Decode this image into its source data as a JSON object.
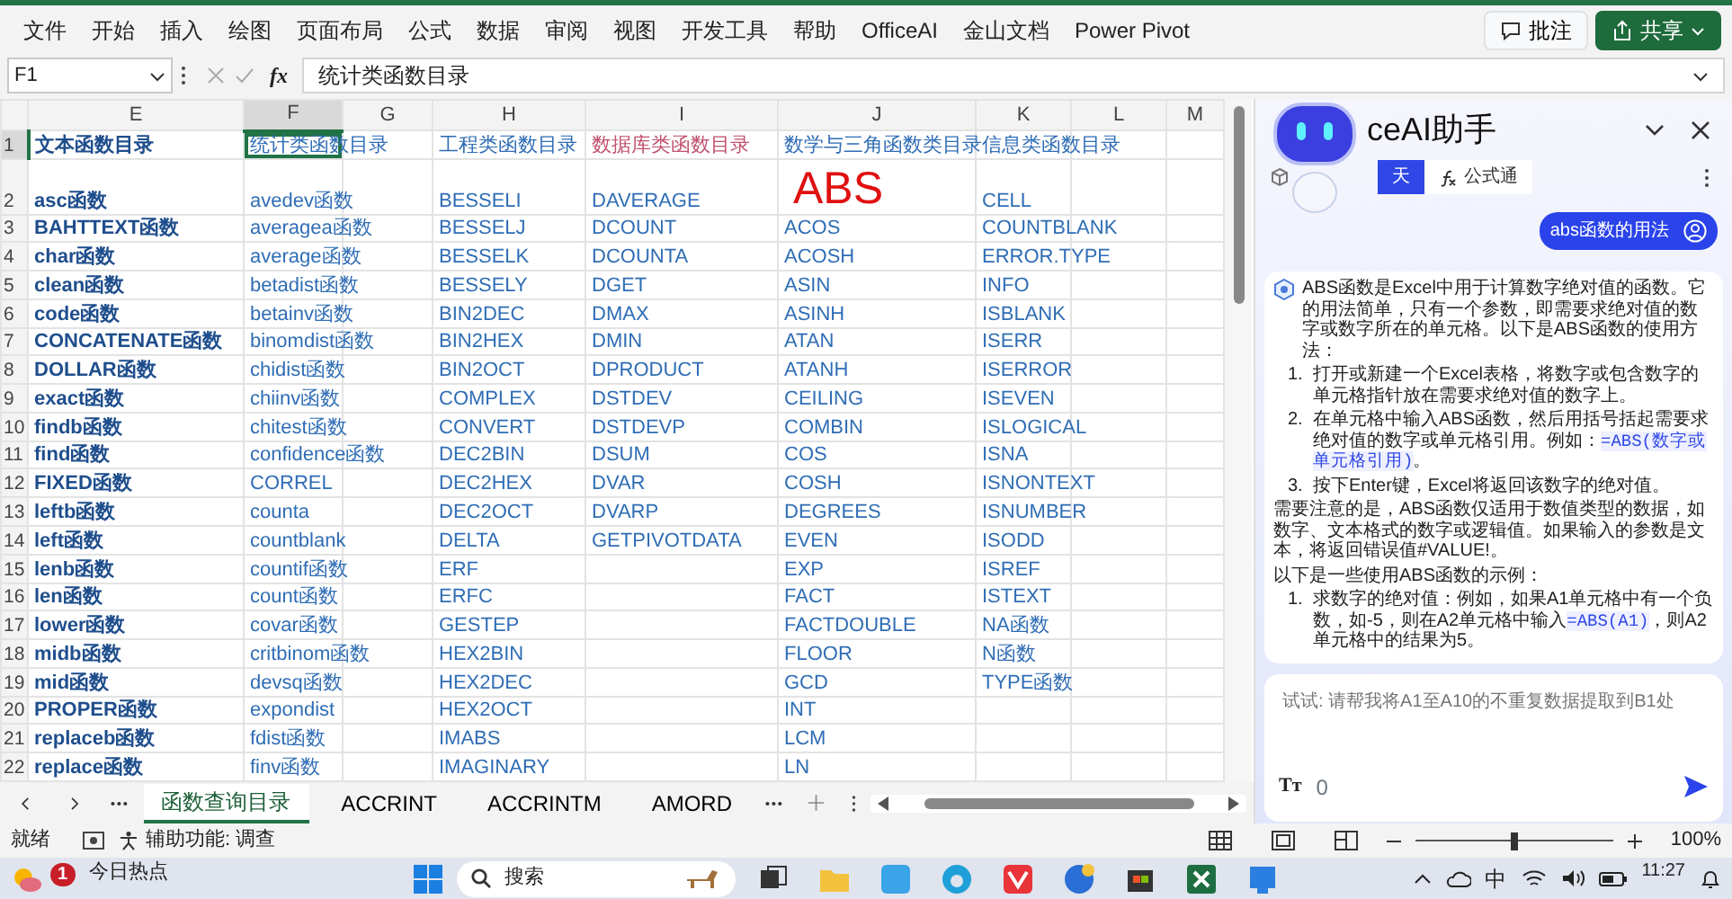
{
  "menu": {
    "items": [
      "文件",
      "开始",
      "插入",
      "绘图",
      "页面布局",
      "公式",
      "数据",
      "审阅",
      "视图",
      "开发工具",
      "帮助",
      "OfficeAI",
      "金山文档",
      "Power Pivot"
    ],
    "comment_button": "批注",
    "share_button": "共享"
  },
  "formula_bar": {
    "name_box": "F1",
    "function_symbol": "fx",
    "formula": "统计类函数目录"
  },
  "sheet": {
    "columns": [
      {
        "label": "E",
        "selected": false
      },
      {
        "label": "F",
        "selected": true
      },
      {
        "label": "G",
        "selected": false
      },
      {
        "label": "H",
        "selected": false
      },
      {
        "label": "I",
        "selected": false
      },
      {
        "label": "J",
        "selected": false
      },
      {
        "label": "K",
        "selected": false
      },
      {
        "label": "L",
        "selected": false
      },
      {
        "label": "M",
        "selected": false
      }
    ],
    "rows": [
      {
        "label": "1",
        "selected": true,
        "cells": {
          "E": {
            "text": "文本函数目录",
            "color": "#1f4e8c"
          },
          "F": {
            "text": "统计类函数目录",
            "color": "#2f6db5",
            "selected": true
          },
          "H": {
            "text": "工程类函数目录",
            "color": "#2f6db5"
          },
          "I": {
            "text": "数据库类函数目录",
            "color": "#c0506e"
          },
          "J": {
            "text": "数学与三角函数类目录",
            "color": "#2f6db5"
          },
          "K": {
            "text": "信息类函数目录",
            "color": "#2f6db5"
          }
        }
      },
      {
        "label": "2",
        "selected": false,
        "cells": {
          "E": "asc函数",
          "F": "avedev函数",
          "H": "BESSELI",
          "I": "DAVERAGE",
          "J": {
            "text": "ABS",
            "kind": "highlight"
          },
          "K": "CELL"
        }
      },
      {
        "label": "3",
        "selected": false,
        "cells": {
          "E": "BAHTTEXT函数",
          "F": "averagea函数",
          "H": "BESSELJ",
          "I": "DCOUNT",
          "J": "ACOS",
          "K": "COUNTBLANK"
        }
      },
      {
        "label": "4",
        "selected": false,
        "cells": {
          "E": "char函数",
          "F": "average函数",
          "H": "BESSELK",
          "I": "DCOUNTA",
          "J": "ACOSH",
          "K": "ERROR.TYPE"
        }
      },
      {
        "label": "5",
        "selected": false,
        "cells": {
          "E": "clean函数",
          "F": "betadist函数",
          "H": "BESSELY",
          "I": "DGET",
          "J": "ASIN",
          "K": "INFO"
        }
      },
      {
        "label": "6",
        "selected": false,
        "cells": {
          "E": "code函数",
          "F": "betainv函数",
          "H": "BIN2DEC",
          "I": "DMAX",
          "J": "ASINH",
          "K": "ISBLANK"
        }
      },
      {
        "label": "7",
        "selected": false,
        "cells": {
          "E": "CONCATENATE函数",
          "F": "binomdist函数",
          "H": "BIN2HEX",
          "I": "DMIN",
          "J": "ATAN",
          "K": "ISERR"
        }
      },
      {
        "label": "8",
        "selected": false,
        "cells": {
          "E": "DOLLAR函数",
          "F": "chidist函数",
          "H": "BIN2OCT",
          "I": "DPRODUCT",
          "J": "ATANH",
          "K": "ISERROR"
        }
      },
      {
        "label": "9",
        "selected": false,
        "cells": {
          "E": "exact函数",
          "F": "chiinv函数",
          "H": "COMPLEX",
          "I": "DSTDEV",
          "J": "CEILING",
          "K": "ISEVEN"
        }
      },
      {
        "label": "10",
        "selected": false,
        "cells": {
          "E": "findb函数",
          "F": "chitest函数",
          "H": "CONVERT",
          "I": "DSTDEVP",
          "J": "COMBIN",
          "K": "ISLOGICAL"
        }
      },
      {
        "label": "11",
        "selected": false,
        "cells": {
          "E": "find函数",
          "F": "confidence函数",
          "H": "DEC2BIN",
          "I": "DSUM",
          "J": "COS",
          "K": "ISNA"
        }
      },
      {
        "label": "12",
        "selected": false,
        "cells": {
          "E": "FIXED函数",
          "F": "CORREL",
          "H": "DEC2HEX",
          "I": "DVAR",
          "J": "COSH",
          "K": "ISNONTEXT"
        }
      },
      {
        "label": "13",
        "selected": false,
        "cells": {
          "E": "leftb函数",
          "F": "counta",
          "H": "DEC2OCT",
          "I": "DVARP",
          "J": "DEGREES",
          "K": "ISNUMBER"
        }
      },
      {
        "label": "14",
        "selected": false,
        "cells": {
          "E": "left函数",
          "F": "countblank",
          "H": "DELTA",
          "I": "GETPIVOTDATA",
          "J": "EVEN",
          "K": "ISODD"
        }
      },
      {
        "label": "15",
        "selected": false,
        "cells": {
          "E": "lenb函数",
          "F": "countif函数",
          "H": "ERF",
          "J": "EXP",
          "K": "ISREF"
        }
      },
      {
        "label": "16",
        "selected": false,
        "cells": {
          "E": "len函数",
          "F": "count函数",
          "H": "ERFC",
          "J": "FACT",
          "K": "ISTEXT"
        }
      },
      {
        "label": "17",
        "selected": false,
        "cells": {
          "E": "lower函数",
          "F": "covar函数",
          "H": "GESTEP",
          "J": "FACTDOUBLE",
          "K": "NA函数"
        }
      },
      {
        "label": "18",
        "selected": false,
        "cells": {
          "E": "midb函数",
          "F": "critbinom函数",
          "H": "HEX2BIN",
          "J": "FLOOR",
          "K": "N函数"
        }
      },
      {
        "label": "19",
        "selected": false,
        "cells": {
          "E": "mid函数",
          "F": "devsq函数",
          "H": "HEX2DEC",
          "J": "GCD",
          "K": "TYPE函数"
        }
      },
      {
        "label": "20",
        "selected": false,
        "cells": {
          "E": "PROPER函数",
          "F": "expondist",
          "H": "HEX2OCT",
          "J": "INT"
        }
      },
      {
        "label": "21",
        "selected": false,
        "cells": {
          "E": "replaceb函数",
          "F": "fdist函数",
          "H": "IMABS",
          "J": "LCM"
        }
      },
      {
        "label": "22",
        "selected": false,
        "cells": {
          "E": "replace函数",
          "F": "finv函数",
          "H": "IMAGINARY",
          "J": "LN"
        }
      }
    ]
  },
  "sheet_tabs": [
    {
      "label": "函数查询目录",
      "selected": true
    },
    {
      "label": "ACCRINT",
      "selected": false
    },
    {
      "label": "ACCRINTM",
      "selected": false
    },
    {
      "label": "AMORD",
      "selected": false
    }
  ],
  "assistant": {
    "title": "ceAI助手",
    "tabs": [
      {
        "label": "天",
        "selected": true
      },
      {
        "label": "公式通",
        "selected": false
      }
    ],
    "user_message": "abs函数的用法",
    "answer": {
      "intro": "ABS函数是Excel中用于计算数字绝对值的函数。它的用法简单，只有一个参数，即需要求绝对值的数字或数字所在的单元格。以下是ABS函数的使用方法：",
      "steps": [
        {
          "number": "1.",
          "text": "打开或新建一个Excel表格，将数字或包含数字的单元格指针放在需要求绝对值的数字上。"
        },
        {
          "number": "2.",
          "text": "在单元格中输入ABS函数，然后用括号括起需要求绝对值的数字或单元格引用。例如：",
          "code": "=ABS(数字或单元格引用)",
          "after": "。"
        },
        {
          "number": "3.",
          "text": "按下Enter键，Excel将返回该数字的绝对值。"
        }
      ],
      "note": "需要注意的是，ABS函数仅适用于数值类型的数据，如数字、文本格式的数字或逻辑值。如果输入的参数是文本，将返回错误值#VALUE!。",
      "examples_intro": "以下是一些使用ABS函数的示例：",
      "examples": [
        {
          "number": "1.",
          "text": "求数字的绝对值：例如，如果A1单元格中有一个负数，如-5，则在A2单元格中输入",
          "code": "=ABS(A1)",
          "after": "，则A2单元格中的结果为5。"
        }
      ]
    },
    "input": {
      "placeholder": "试试: 请帮我将A1至A10的不重复数据提取到B1处",
      "font_button": "Tт",
      "char_count": "0"
    }
  },
  "status_bar": {
    "ready": "就绪",
    "accessibility": "辅助功能: 调查",
    "zoom_slider": {
      "level": 0.5
    },
    "zoom": "100%"
  },
  "taskbar": {
    "news_badge": "1",
    "news_title": "今日热点",
    "search": "搜索",
    "ime": "中",
    "time": "11:27"
  }
}
